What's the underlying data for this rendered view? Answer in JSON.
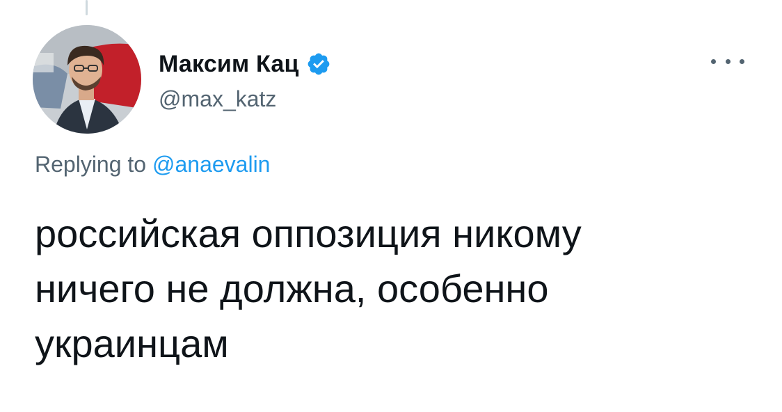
{
  "author": {
    "display_name": "Максим Кац",
    "handle": "@max_katz",
    "verified_icon": "verified-badge-icon",
    "verified_color": "#1d9bf0"
  },
  "reply": {
    "prefix": "Replying to",
    "mention": "@anaevalin"
  },
  "tweet": {
    "lines": [
      "российская оппозиция никому",
      "ничего не должна, особенно",
      "украинцам"
    ]
  },
  "colors": {
    "text": "#0f1419",
    "secondary": "#536471",
    "accent": "#1d9bf0",
    "thread_line": "#cfd9de"
  }
}
